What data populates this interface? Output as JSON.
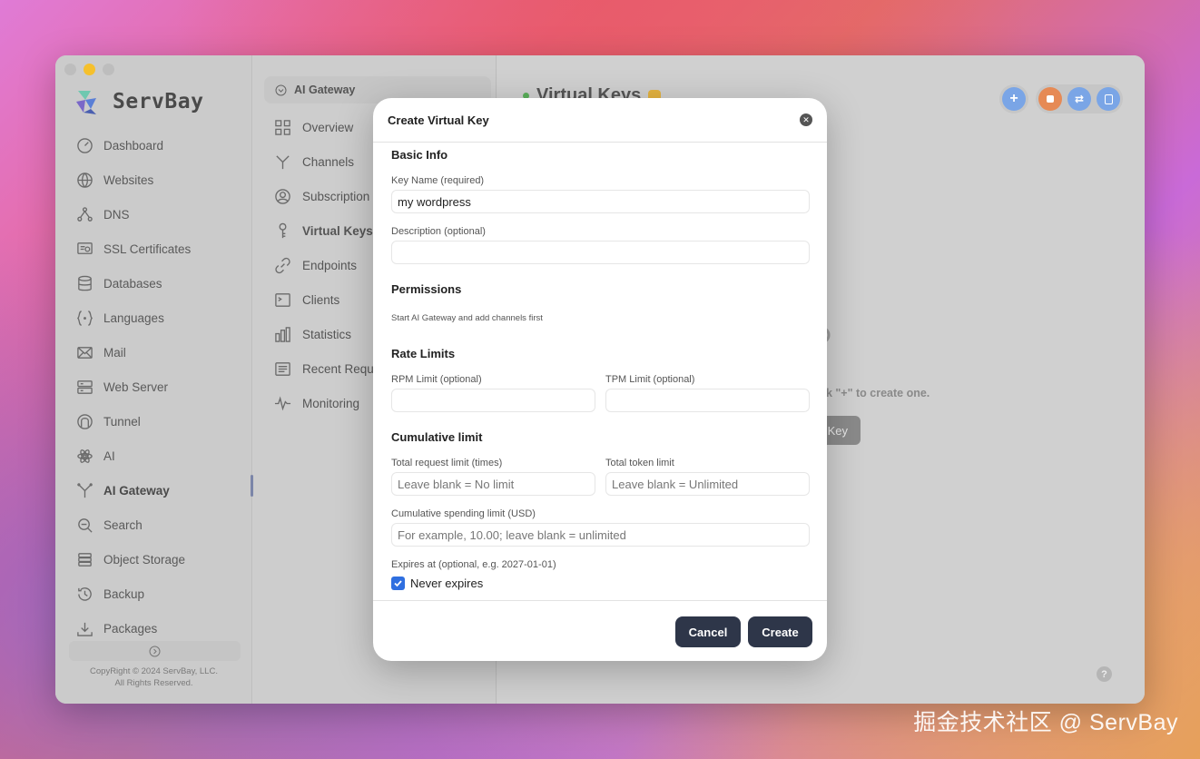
{
  "app": {
    "name": "ServBay",
    "copyright_line1": "CopyRight © 2024 ServBay, LLC.",
    "copyright_line2": "All Rights Reserved."
  },
  "sidebar": {
    "items": [
      {
        "label": "Dashboard",
        "icon": "gauge-icon"
      },
      {
        "label": "Websites",
        "icon": "globe-icon"
      },
      {
        "label": "DNS",
        "icon": "dns-icon"
      },
      {
        "label": "SSL Certificates",
        "icon": "certificate-icon"
      },
      {
        "label": "Databases",
        "icon": "database-icon"
      },
      {
        "label": "Languages",
        "icon": "braces-icon"
      },
      {
        "label": "Mail",
        "icon": "mail-icon"
      },
      {
        "label": "Web Server",
        "icon": "server-icon"
      },
      {
        "label": "Tunnel",
        "icon": "tunnel-icon"
      },
      {
        "label": "AI",
        "icon": "atom-icon"
      },
      {
        "label": "AI Gateway",
        "icon": "gateway-icon"
      },
      {
        "label": "Search",
        "icon": "search-icon"
      },
      {
        "label": "Object Storage",
        "icon": "storage-icon"
      },
      {
        "label": "Backup",
        "icon": "backup-icon"
      },
      {
        "label": "Packages",
        "icon": "packages-icon"
      }
    ],
    "active": "AI Gateway"
  },
  "subpanel": {
    "header": "AI Gateway",
    "items": [
      {
        "label": "Overview",
        "icon": "grid-icon"
      },
      {
        "label": "Channels",
        "icon": "fork-icon"
      },
      {
        "label": "Subscription",
        "icon": "user-circle-icon"
      },
      {
        "label": "Virtual Keys",
        "icon": "key-icon"
      },
      {
        "label": "Endpoints",
        "icon": "link-icon"
      },
      {
        "label": "Clients",
        "icon": "terminal-icon"
      },
      {
        "label": "Statistics",
        "icon": "bar-chart-icon"
      },
      {
        "label": "Recent Reque",
        "icon": "list-icon"
      },
      {
        "label": "Monitoring",
        "icon": "pulse-icon"
      }
    ],
    "active": "Virtual Keys"
  },
  "main": {
    "title": "Virtual Keys",
    "empty_hint": "ck \"+\" to create one.",
    "empty_button": "Key",
    "toolbar": [
      "plus-icon",
      "stop-icon",
      "sync-icon",
      "log-icon"
    ],
    "colors": {
      "accent_blue": "#7aa5e6",
      "stop_orange": "#e68a55"
    }
  },
  "modal": {
    "title": "Create Virtual Key",
    "basic_info": "Basic Info",
    "key_name_label": "Key Name (required)",
    "key_name_value": "my wordpress",
    "description_label": "Description (optional)",
    "description_value": "",
    "permissions": "Permissions",
    "permissions_hint": "Start AI Gateway and add channels first",
    "rate_limits": "Rate Limits",
    "rpm_label": "RPM Limit (optional)",
    "tpm_label": "TPM Limit (optional)",
    "cumulative_limit": "Cumulative limit",
    "total_request_label": "Total request limit (times)",
    "total_request_placeholder": "Leave blank = No limit",
    "total_token_label": "Total token limit",
    "total_token_placeholder": "Leave blank = Unlimited",
    "spending_label": "Cumulative spending limit (USD)",
    "spending_placeholder": "For example, 10.00; leave blank = unlimited",
    "expires_label": "Expires at (optional, e.g. 2027-01-01)",
    "never_expires": "Never expires",
    "never_expires_checked": true,
    "cancel": "Cancel",
    "create": "Create",
    "button_color": "#2e3649"
  },
  "watermark": "掘金技术社区 @ ServBay"
}
